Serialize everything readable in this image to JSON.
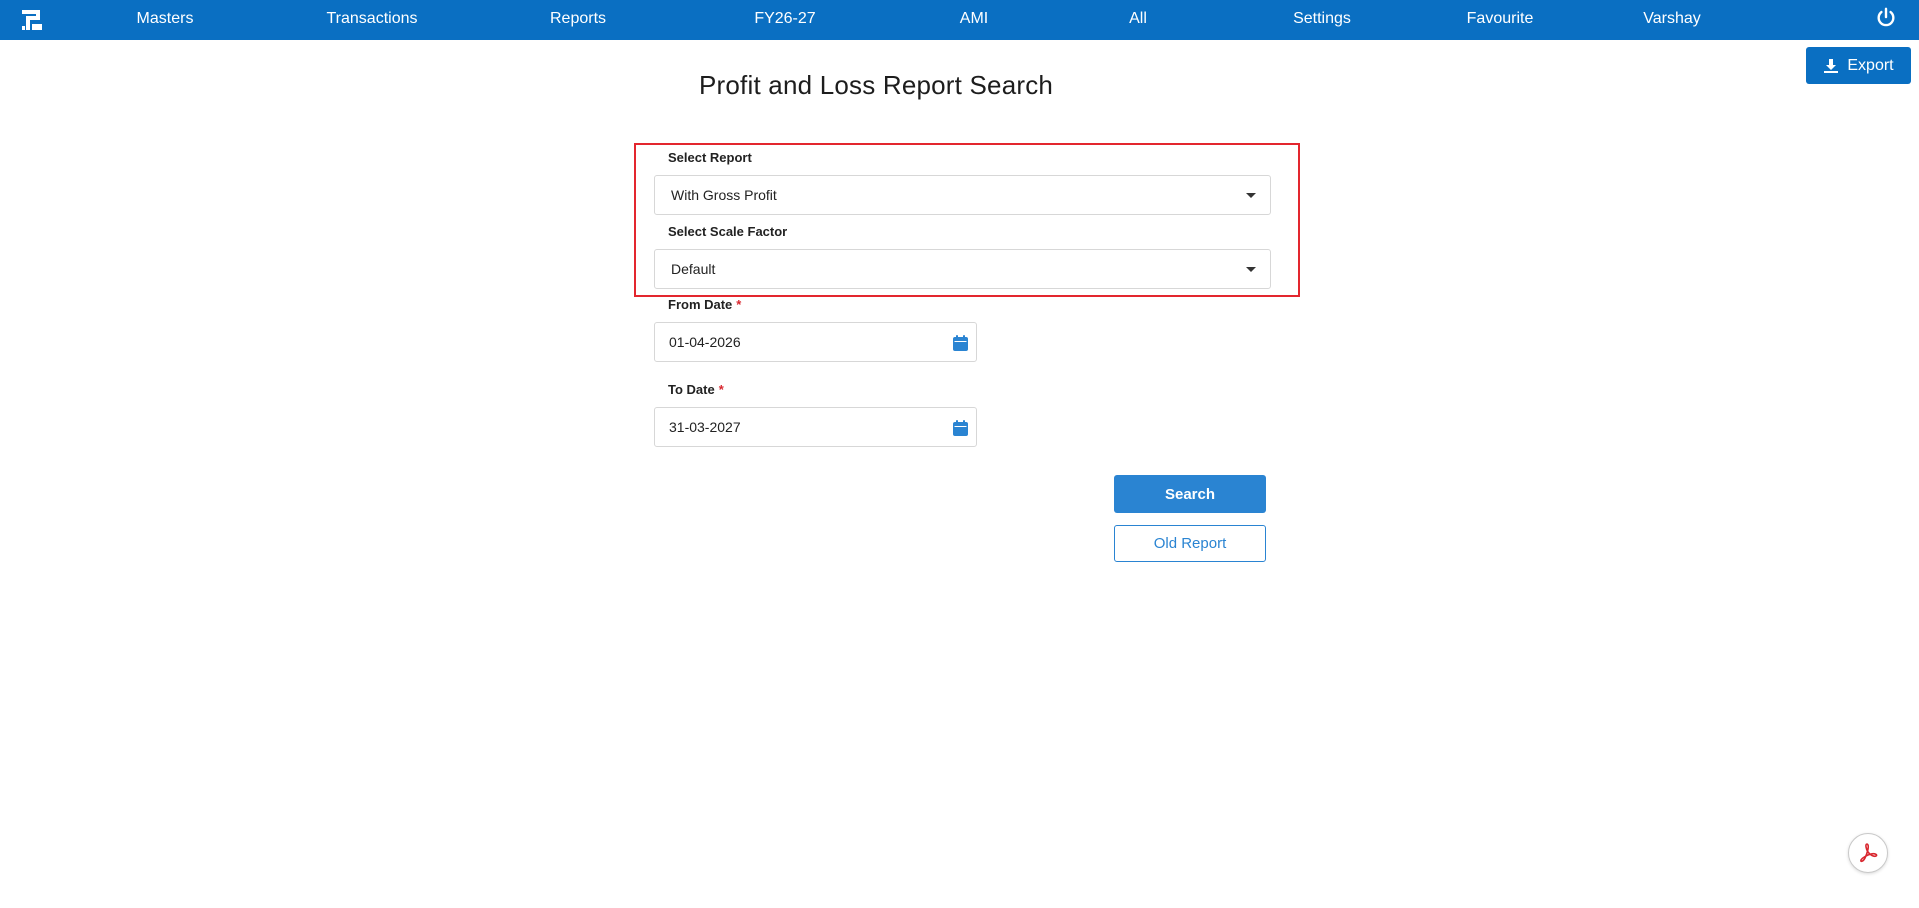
{
  "nav": {
    "items": [
      "Masters",
      "Transactions",
      "Reports",
      "FY26-27",
      "AMI",
      "All",
      "Settings",
      "Favourite",
      "Varshay"
    ]
  },
  "export": {
    "label": "Export"
  },
  "page": {
    "title": "Profit and Loss Report Search"
  },
  "form": {
    "select_report": {
      "label": "Select Report",
      "value": "With Gross Profit"
    },
    "scale_factor": {
      "label": "Select Scale Factor",
      "value": "Default"
    },
    "from_date": {
      "label": "From Date",
      "required_mark": "*",
      "value": "01-04-2026"
    },
    "to_date": {
      "label": "To Date",
      "required_mark": "*",
      "value": "31-03-2027"
    }
  },
  "buttons": {
    "search": "Search",
    "old_report": "Old Report"
  },
  "colors": {
    "primary": "#0a6fc2",
    "button": "#2a84d2",
    "highlight": "#e3262e",
    "required": "#d8262e"
  },
  "icons": {
    "logo": "app-logo-icon",
    "power": "power-icon",
    "export": "download-icon",
    "calendar": "calendar-icon",
    "pdf": "pdf-icon",
    "dropdown": "caret-down-icon"
  }
}
